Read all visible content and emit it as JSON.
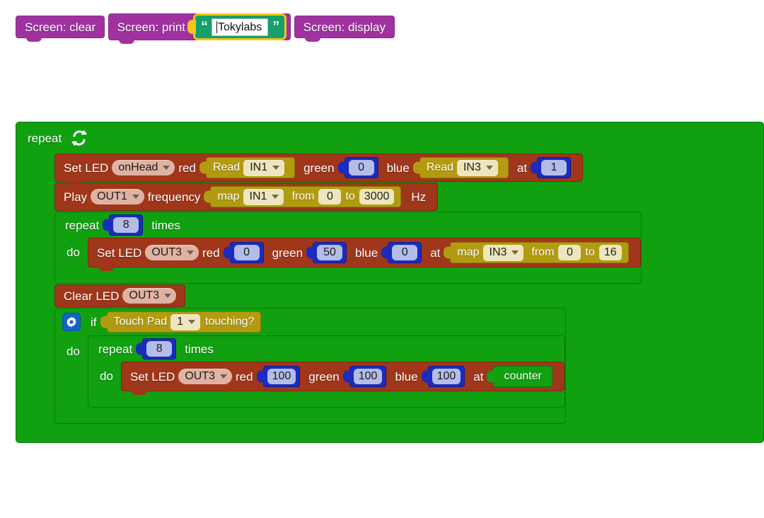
{
  "workspace": {
    "background": "#ffffff",
    "colors": {
      "screen_block": "#A032A0",
      "loop_block": "#10A010",
      "led_block": "#A0361A",
      "sensor_block": "#B39B10",
      "number_block": "#1A2CBF",
      "string_block": "#16A06A",
      "selection_highlight": "#F5C518",
      "variable_block": "#10A010"
    }
  },
  "screen_stack": {
    "clear": {
      "label": "Screen: clear"
    },
    "print": {
      "label": "Screen: print",
      "string_value": "Tokylabs",
      "quote_open": "“",
      "quote_close": "”",
      "selected": true
    },
    "display": {
      "label": "Screen: display"
    }
  },
  "main_loop": {
    "label": "repeat",
    "icon": "loop-arrows-icon",
    "set_led_head": {
      "label": "Set LED",
      "target": "onHead",
      "red_label": "red",
      "red_value": {
        "kind": "sensor",
        "label": "Read",
        "port": "IN1"
      },
      "green_label": "green",
      "green_value": {
        "kind": "number",
        "value": "0"
      },
      "blue_label": "blue",
      "blue_value": {
        "kind": "sensor",
        "label": "Read",
        "port": "IN3"
      },
      "at_label": "at",
      "at_value": {
        "kind": "number",
        "value": "1"
      }
    },
    "play_tone": {
      "label": "Play",
      "port": "OUT1",
      "frequency_label": "frequency",
      "map": {
        "label": "map",
        "source": "IN1",
        "from_label": "from",
        "from_value": "0",
        "to_label": "to",
        "to_value": "3000"
      },
      "unit": "Hz"
    },
    "repeat_8": {
      "label": "repeat",
      "count": "8",
      "times_label": "times",
      "do_label": "do",
      "set_led": {
        "label": "Set LED",
        "target": "OUT3",
        "red_label": "red",
        "red_value": {
          "kind": "number",
          "value": "0"
        },
        "green_label": "green",
        "green_value": {
          "kind": "number",
          "value": "50"
        },
        "blue_label": "blue",
        "blue_value": {
          "kind": "number",
          "value": "0"
        },
        "at_label": "at",
        "at_map": {
          "label": "map",
          "source": "IN3",
          "from_label": "from",
          "from_value": "0",
          "to_label": "to",
          "to_value": "16"
        }
      }
    },
    "clear_led": {
      "label": "Clear LED",
      "target": "OUT3"
    },
    "if_block": {
      "gear_icon": "gear-icon",
      "if_label": "if",
      "condition": {
        "label": "Touch Pad",
        "pad": "1",
        "suffix": "touching?"
      },
      "do_label": "do",
      "repeat_8": {
        "label": "repeat",
        "count": "8",
        "times_label": "times",
        "do_label": "do",
        "set_led": {
          "label": "Set LED",
          "target": "OUT3",
          "red_label": "red",
          "red_value": {
            "kind": "number",
            "value": "100"
          },
          "green_label": "green",
          "green_value": {
            "kind": "number",
            "value": "100"
          },
          "blue_label": "blue",
          "blue_value": {
            "kind": "number",
            "value": "100"
          },
          "at_label": "at",
          "at_variable": "counter"
        }
      }
    }
  }
}
